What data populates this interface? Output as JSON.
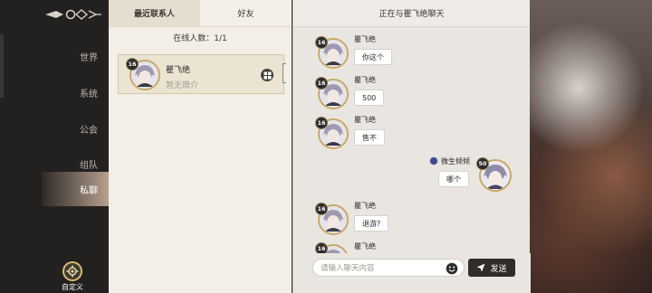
{
  "sidebar": {
    "items": [
      {
        "label": "世界",
        "active": false
      },
      {
        "label": "系统",
        "active": false
      },
      {
        "label": "公会",
        "active": false
      },
      {
        "label": "组队",
        "active": false
      },
      {
        "label": "私聊",
        "active": true
      }
    ],
    "custom_label": "自定义"
  },
  "contacts": {
    "tabs": [
      {
        "label": "最近联系人",
        "active": true
      },
      {
        "label": "好友",
        "active": false
      }
    ],
    "online_count": "在线人数：1/1",
    "list": [
      {
        "name": "瞿飞绝",
        "bio": "暂无简介",
        "level": "16"
      }
    ]
  },
  "chat": {
    "header": "正在与瞿飞绝聊天",
    "messages": [
      {
        "sender": "瞿飞绝",
        "text": "你这个",
        "level": "16",
        "self": false
      },
      {
        "sender": "瞿飞绝",
        "text": "500",
        "level": "16",
        "self": false
      },
      {
        "sender": "瞿飞绝",
        "text": "售不",
        "level": "16",
        "self": false
      },
      {
        "sender": "微生倾倾",
        "text": "哪个",
        "level": "50",
        "self": true
      },
      {
        "sender": "瞿飞绝",
        "text": "退游?",
        "level": "16",
        "self": false
      },
      {
        "sender": "瞿飞绝",
        "text": "",
        "level": "16",
        "self": false
      }
    ],
    "input_placeholder": "请输入聊天内容",
    "send_label": "发送"
  },
  "icons": {
    "top": "ornament-icon",
    "custom": "gear-icon",
    "add": "add-friend-icon",
    "emoji": "emoji-icon",
    "send": "paper-plane-icon",
    "self_badge": "gender-badge-icon"
  },
  "colors": {
    "sidebar_bg": "#232120",
    "panel_bg": "#f3efe7",
    "chat_bg": "#e9e6e2",
    "accent_gold": "#c9a865",
    "button_dark": "#2f2c2a"
  }
}
